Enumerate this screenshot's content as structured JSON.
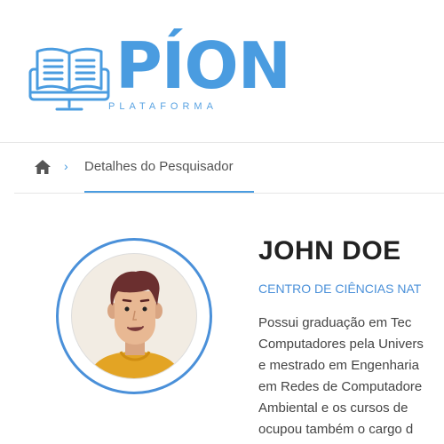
{
  "brand": {
    "logo_text": "PÍON",
    "logo_sub": "PLATAFORMA",
    "color": "#4a9ce0"
  },
  "breadcrumb": {
    "home_icon": "home-icon",
    "separator": "›",
    "current": "Detalhes do Pesquisador"
  },
  "researcher": {
    "name": "JOHN DOE",
    "center": "CENTRO DE CIÊNCIAS NAT",
    "bio_lines": [
      "Possui graduação em Tec",
      "Computadores pela Univers",
      "e mestrado em Engenharia",
      "em Redes de Computadore",
      "Ambiental e os cursos de",
      "ocupou também o cargo d"
    ]
  },
  "colors": {
    "accent": "#4a90d9",
    "avatar_bg": "#f2ece3",
    "hair": "#6b2f2f",
    "skin": "#e8b893",
    "shirt": "#e3a424"
  }
}
